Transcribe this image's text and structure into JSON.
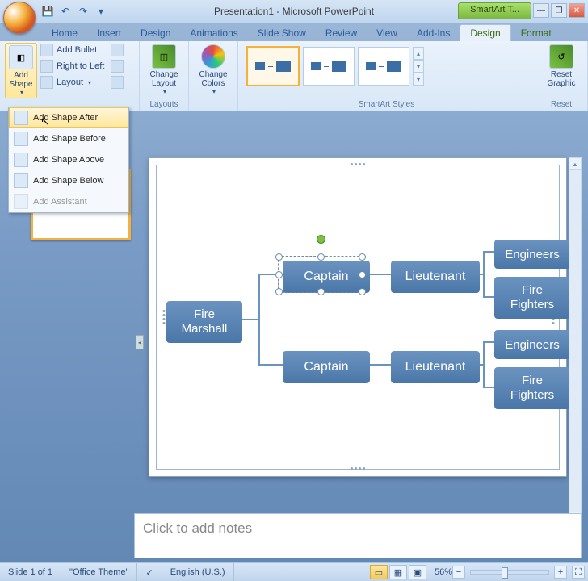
{
  "title": "Presentation1 - Microsoft PowerPoint",
  "contextual_tools_label": "SmartArt T...",
  "window_controls": {
    "min": "—",
    "restore": "❐",
    "close": "✕"
  },
  "qat": {
    "save_icon": "💾",
    "undo_icon": "↶",
    "redo_icon": "↷",
    "more_icon": "▾"
  },
  "tabs": {
    "home": "Home",
    "insert": "Insert",
    "design_primary": "Design",
    "animations": "Animations",
    "slideshow": "Slide Show",
    "review": "Review",
    "view": "View",
    "addins": "Add-Ins",
    "design_context": "Design",
    "format_context": "Format"
  },
  "ribbon": {
    "add_shape": "Add\nShape",
    "add_bullet": "Add Bullet",
    "right_to_left": "Right to Left",
    "layout": "Layout",
    "change_layout": "Change\nLayout",
    "layouts_label": "Layouts",
    "change_colors": "Change\nColors",
    "smartart_styles_label": "SmartArt Styles",
    "reset_graphic": "Reset\nGraphic",
    "reset_label": "Reset"
  },
  "add_shape_menu": {
    "after": "Add Shape After",
    "before": "Add Shape Before",
    "above": "Add Shape Above",
    "below": "Add Shape Below",
    "assistant": "Add Assistant"
  },
  "chart_data": {
    "type": "hierarchy",
    "selected_node": "captain_1",
    "nodes": [
      {
        "id": "root",
        "label": "Fire Marshall"
      },
      {
        "id": "captain_1",
        "label": "Captain",
        "parent": "root"
      },
      {
        "id": "captain_2",
        "label": "Captain",
        "parent": "root"
      },
      {
        "id": "lt_1",
        "label": "Lieutenant",
        "parent": "captain_1"
      },
      {
        "id": "lt_2",
        "label": "Lieutenant",
        "parent": "captain_2"
      },
      {
        "id": "eng_1",
        "label": "Engineers",
        "parent": "lt_1"
      },
      {
        "id": "ff_1",
        "label": "Fire Fighters",
        "parent": "lt_1"
      },
      {
        "id": "eng_2",
        "label": "Engineers",
        "parent": "lt_2"
      },
      {
        "id": "ff_2",
        "label": "Fire Fighters",
        "parent": "lt_2"
      }
    ]
  },
  "notes_placeholder": "Click to add notes",
  "status": {
    "slide_info": "Slide 1 of 1",
    "theme": "\"Office Theme\"",
    "language": "English (U.S.)",
    "zoom": "56%"
  }
}
